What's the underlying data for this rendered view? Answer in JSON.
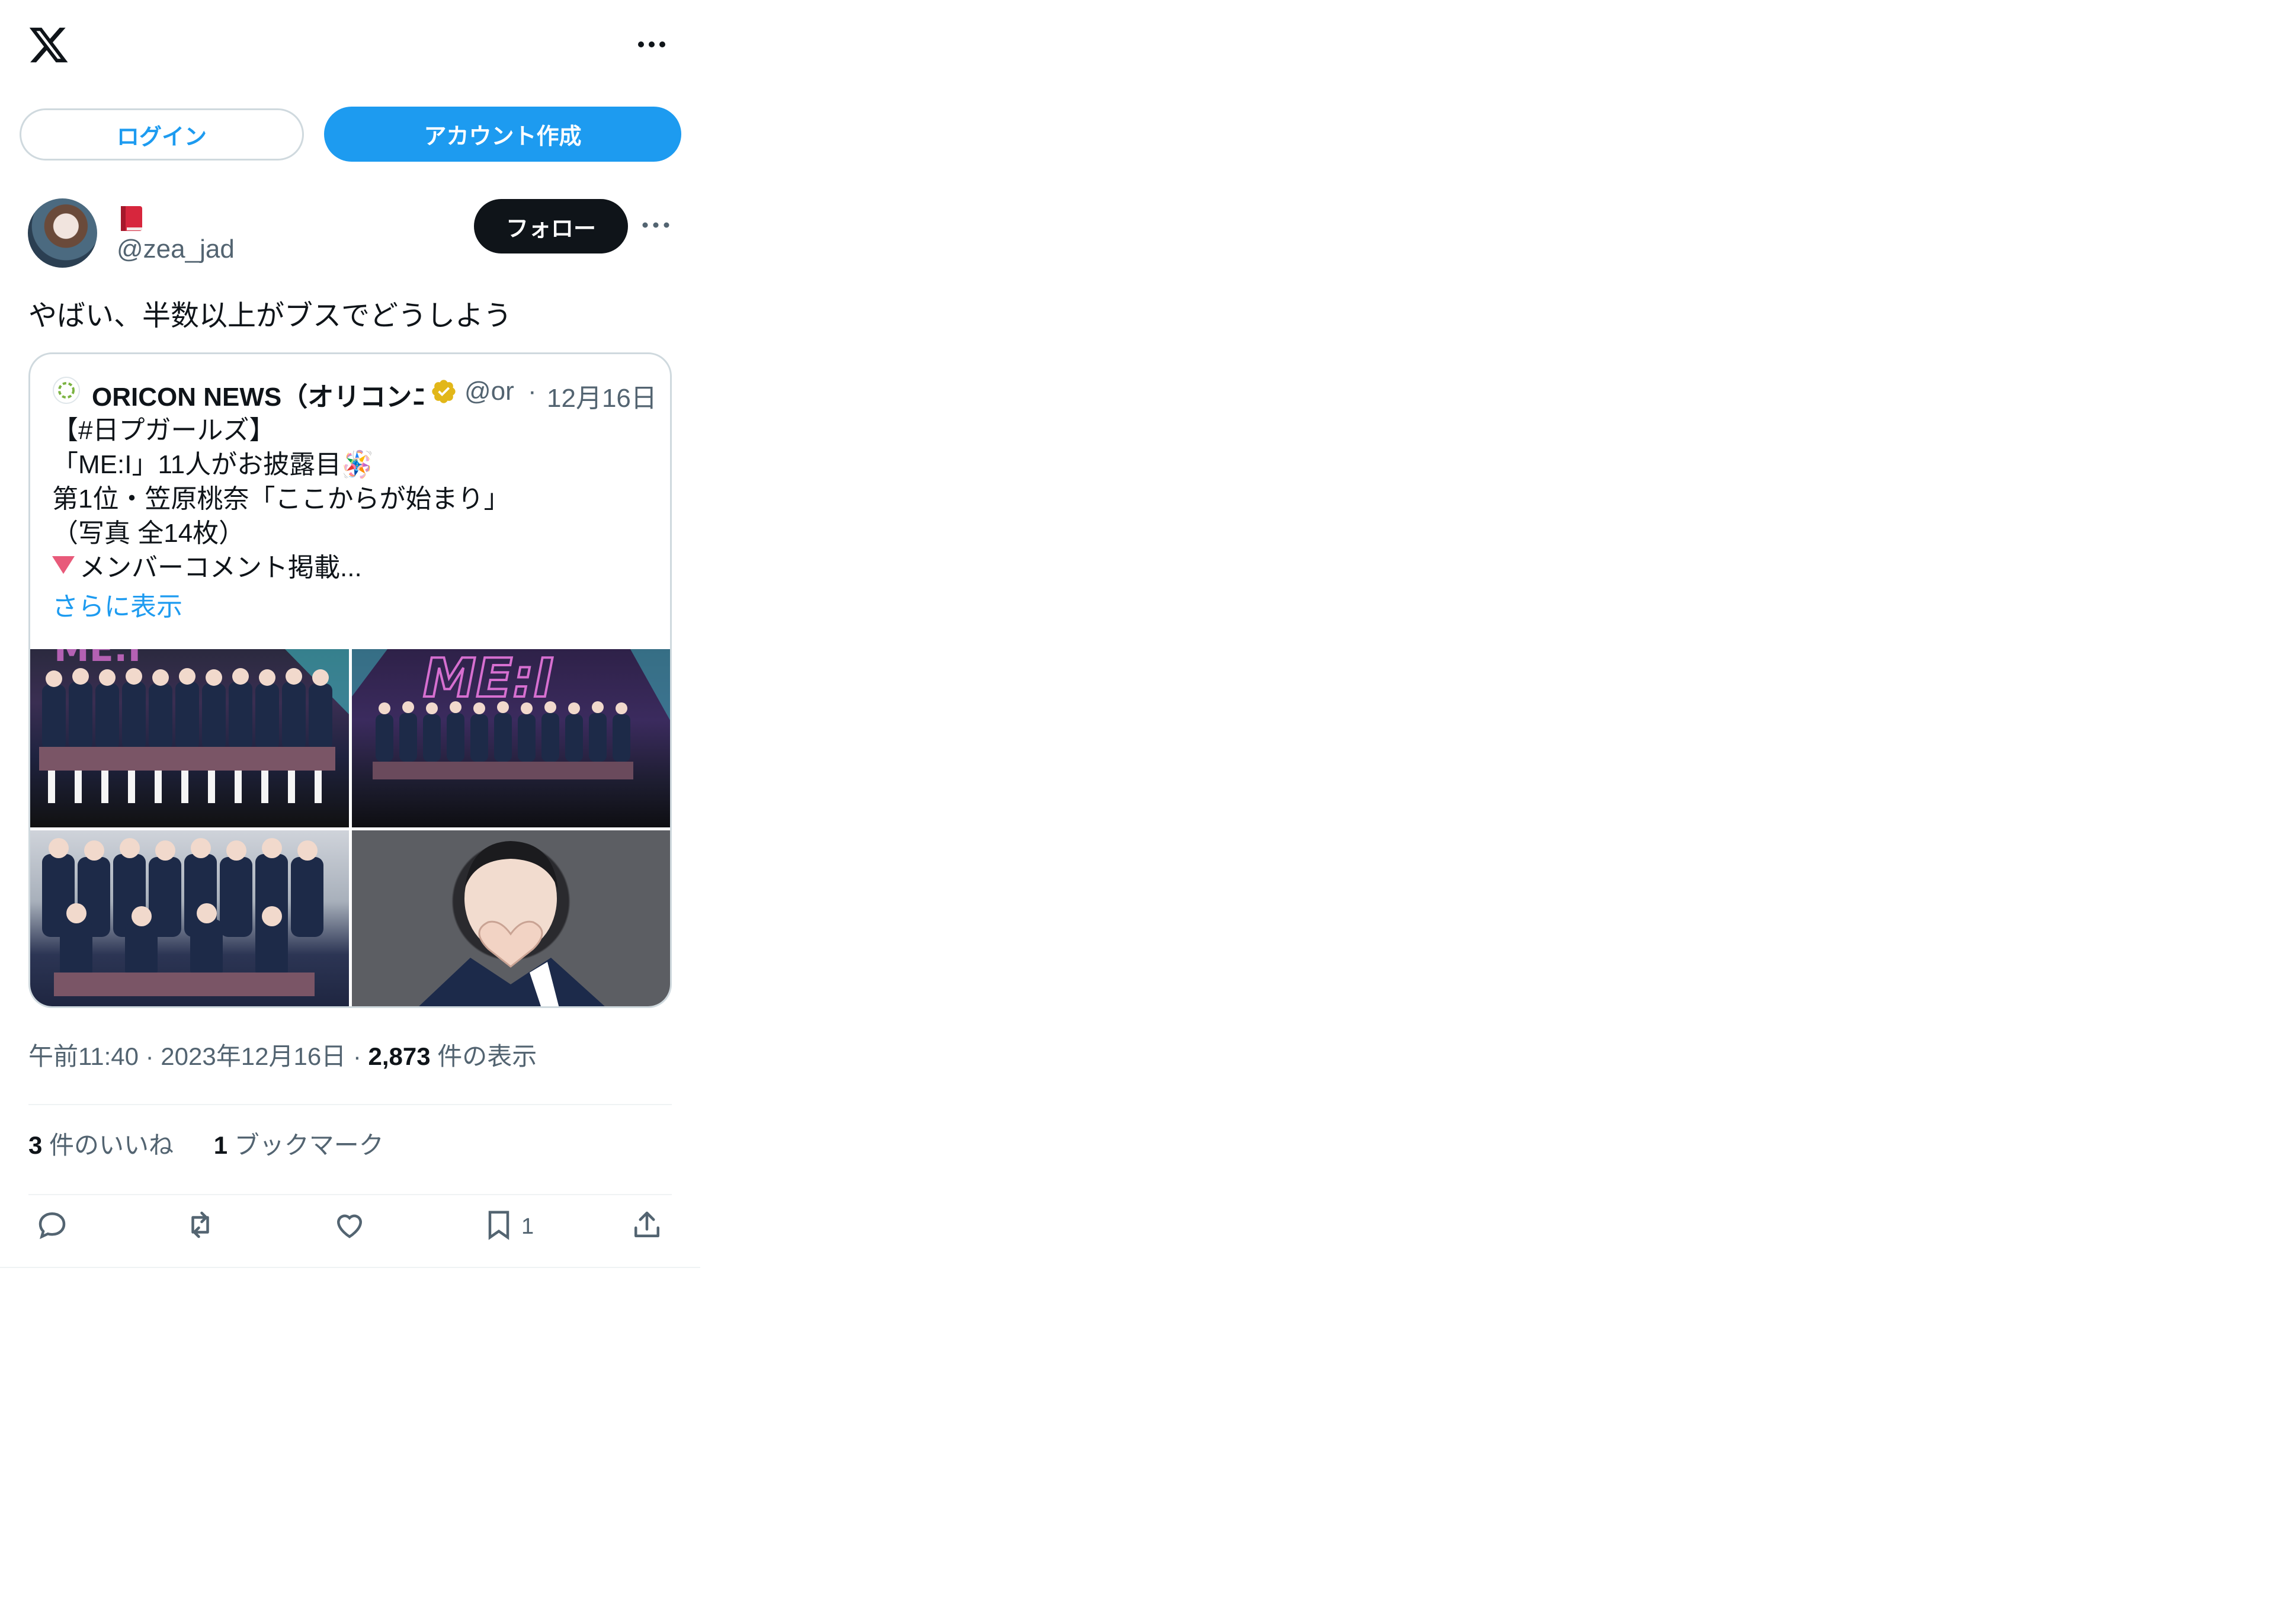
{
  "header": {
    "logo_icon": "x-logo-icon",
    "more_icon": "more-horizontal-icon",
    "login_label": "ログイン",
    "signup_label": "アカウント作成"
  },
  "tweet": {
    "author_emoji": "closed-book-emoji",
    "handle": "@zea_jad",
    "follow_label": "フォロー",
    "text": "やばい、半数以上がブスでどうしよう",
    "timestamp": "午前11:40 · 2023年12月16日 · ",
    "views_count": "2,873",
    "views_label": " 件の表示",
    "likes_count": "3",
    "likes_label": " 件のいいね",
    "bookmarks_count": "1",
    "bookmarks_label": " ブックマーク"
  },
  "quote": {
    "name": "ORICON NEWS（オリコンニュース）",
    "handle": "@or",
    "dot": "·",
    "date": "12月16日",
    "lines": [
      "【#日プガールズ】",
      "「ME:I」11人がお披露目🪅",
      "第1位・笠原桃奈「ここからが始まり」",
      "（写真 全14枚）",
      "メンバーコメント掲載..."
    ],
    "show_more": "さらに表示",
    "image_text": "ME:I"
  },
  "actions": {
    "reply_icon": "reply-icon",
    "retweet_icon": "retweet-icon",
    "like_icon": "heart-icon",
    "bookmark_icon": "bookmark-icon",
    "bookmark_count": "1",
    "share_icon": "share-icon"
  },
  "colors": {
    "accent": "#1d9bf0",
    "text": "#0f1419",
    "secondary": "#536471",
    "border": "#cfd9de",
    "verified_gold": "#e2b719"
  }
}
